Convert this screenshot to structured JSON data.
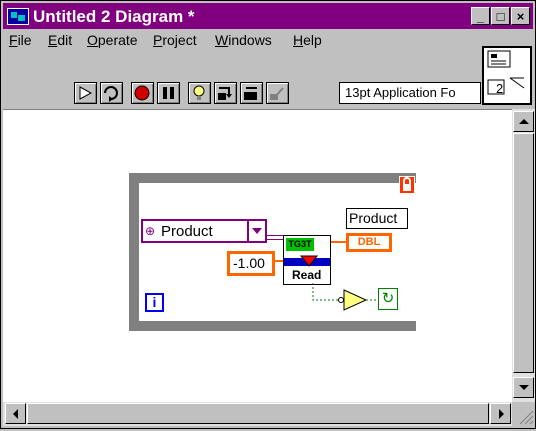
{
  "window": {
    "title": "Untitled 2 Diagram *",
    "controls": {
      "minimize": "_",
      "maximize": "□",
      "close": "×"
    }
  },
  "menu": [
    {
      "label": "File"
    },
    {
      "label": "Edit"
    },
    {
      "label": "Operate"
    },
    {
      "label": "Project"
    },
    {
      "label": "Windows"
    },
    {
      "label": "Help"
    }
  ],
  "toolbar": {
    "font_selector": "13pt Application Fo"
  },
  "connector_pane": {
    "number": "2"
  },
  "diagram": {
    "enum_label": "Product",
    "constant_value": "-1.00",
    "node_label": "Read",
    "node_header": "TG3T",
    "indicator_label": "Product",
    "indicator_type": "DBL",
    "iteration_terminal": "i",
    "stop_glyph": "↻"
  },
  "colors": {
    "title_bar": "#800080",
    "loop_border": "#808080",
    "enum_purple": "#800080",
    "numeric_orange": "#ff6600",
    "loop_icon_blue": "#0000ff",
    "stop_green": "#008000"
  }
}
